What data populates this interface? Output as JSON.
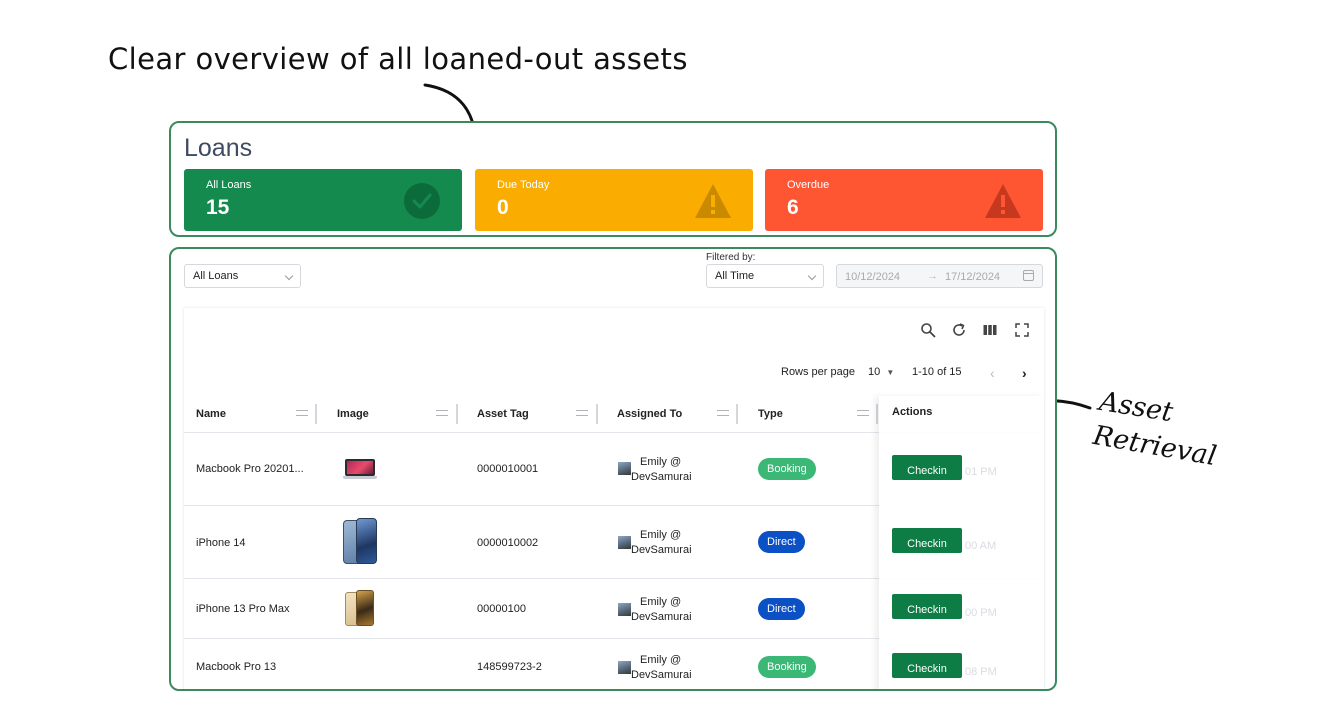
{
  "annotations": {
    "headline": "Clear overview of all loaned-out assets",
    "callout_line1": "Asset",
    "callout_line2": "Retrieval"
  },
  "page": {
    "title": "Loans"
  },
  "stats": [
    {
      "label": "All Loans",
      "value": "15",
      "color": "#148a4e",
      "icon": "check-circle-icon"
    },
    {
      "label": "Due Today",
      "value": "0",
      "color": "#fbac00",
      "icon": "warning-triangle-icon"
    },
    {
      "label": "Overdue",
      "value": "6",
      "color": "#fe5533",
      "icon": "warning-triangle-icon"
    }
  ],
  "filters": {
    "loan_type": "All Loans",
    "filtered_by_label": "Filtered by:",
    "period": "All Time",
    "date_from": "10/12/2024",
    "date_sep": "→",
    "date_to": "17/12/2024"
  },
  "toolbar": {
    "icons": [
      "search-icon",
      "refresh-icon",
      "columns-icon",
      "fullscreen-icon"
    ]
  },
  "pagination": {
    "rows_per_page_label": "Rows per page",
    "rows_per_page": "10",
    "range": "1-10 of 15",
    "prev": "‹",
    "next": "›"
  },
  "table": {
    "columns": [
      "Name",
      "Image",
      "Asset Tag",
      "Assigned To",
      "Type",
      "Actions"
    ],
    "rows": [
      {
        "name": "Macbook Pro 20201...",
        "image": "laptop",
        "asset_tag": "0000010001",
        "assigned_line1": "Emily @",
        "assigned_line2": "DevSamurai",
        "type": "Booking",
        "action": "Checkin",
        "ghost": "01 PM"
      },
      {
        "name": "iPhone 14",
        "image": "phone-blue",
        "asset_tag": "0000010002",
        "assigned_line1": "Emily @",
        "assigned_line2": "DevSamurai",
        "type": "Direct",
        "action": "Checkin",
        "ghost": "00 AM"
      },
      {
        "name": "iPhone 13 Pro Max",
        "image": "phone-gold",
        "asset_tag": "00000100",
        "assigned_line1": "Emily @",
        "assigned_line2": "DevSamurai",
        "type": "Direct",
        "action": "Checkin",
        "ghost": "00 PM"
      },
      {
        "name": "Macbook Pro 13",
        "image": "",
        "asset_tag": "148599723-2",
        "assigned_line1": "Emily @",
        "assigned_line2": "DevSamurai",
        "type": "Booking",
        "action": "Checkin",
        "ghost": "08 PM"
      }
    ]
  },
  "colors": {
    "accent_green": "#0e7c45",
    "booking": "#3bb776",
    "direct": "#0b50c4",
    "panel_border": "#3b8a5e"
  }
}
